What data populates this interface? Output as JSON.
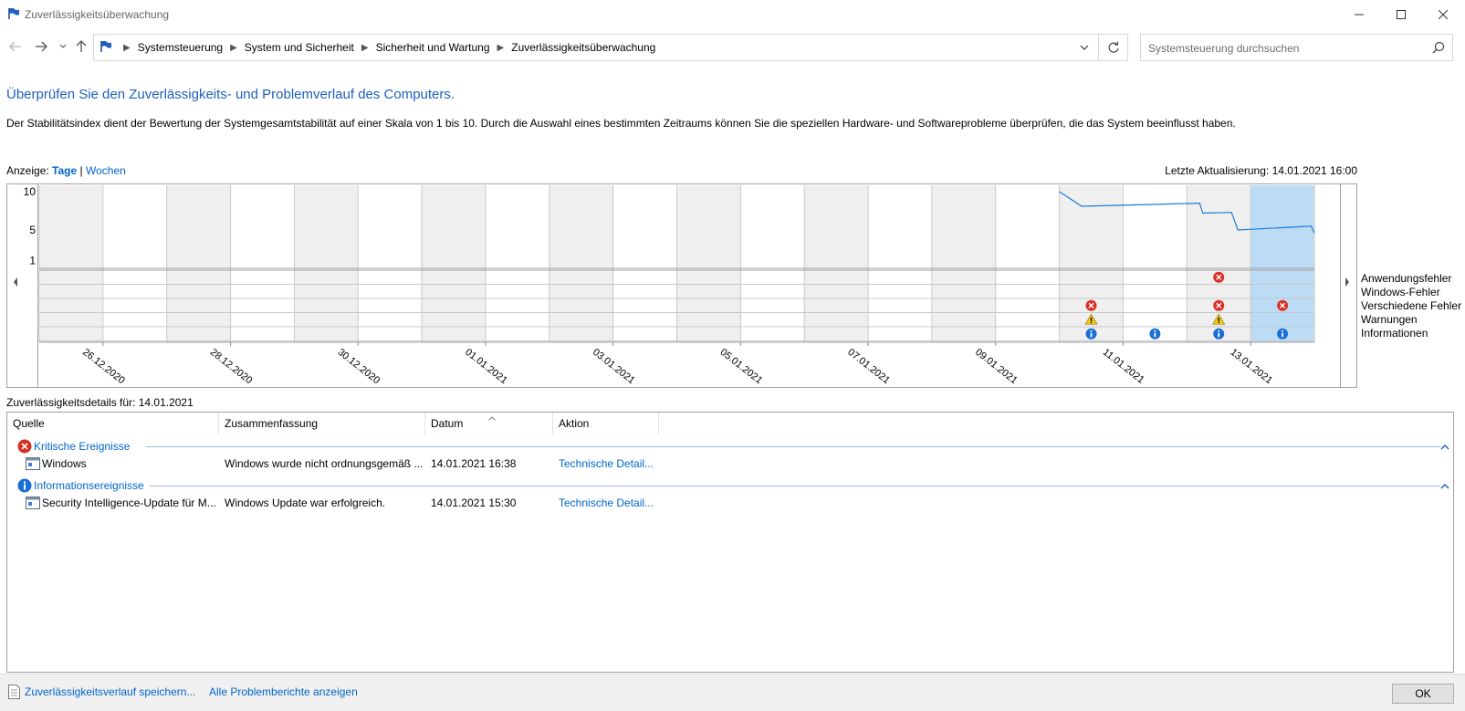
{
  "window": {
    "title": "Zuverlässigkeitsüberwachung"
  },
  "breadcrumbs": [
    "Systemsteuerung",
    "System und Sicherheit",
    "Sicherheit und Wartung",
    "Zuverlässigkeitsüberwachung"
  ],
  "search": {
    "placeholder": "Systemsteuerung durchsuchen"
  },
  "main": {
    "heading": "Überprüfen Sie den Zuverlässigkeits- und Problemverlauf des Computers.",
    "description": "Der Stabilitätsindex dient der Bewertung der Systemgesamtstabilität auf einer Skala von 1 bis 10. Durch die Auswahl eines bestimmten Zeitraums können Sie die speziellen Hardware- und Softwareprobleme überprüfen, die das System beeinflusst haben.",
    "view_label": "Anzeige:",
    "view_days": "Tage",
    "view_sep": "|",
    "view_weeks": "Wochen",
    "last_update": "Letzte Aktualisierung: 14.01.2021 16:00"
  },
  "chart_data": {
    "type": "line",
    "ylim": [
      1,
      10
    ],
    "yticks": [
      "10",
      "5",
      "1"
    ],
    "columns": 20,
    "selected_column": 19,
    "date_labels": [
      "26.12.2020",
      "28.12.2020",
      "30.12.2020",
      "01.01.2021",
      "03.01.2021",
      "05.01.2021",
      "07.01.2021",
      "09.01.2021",
      "11.01.2021",
      "13.01.2021"
    ],
    "stability": [
      {
        "x": 16.0,
        "y": 10.0
      },
      {
        "x": 16.35,
        "y": 8.1
      },
      {
        "x": 18.2,
        "y": 8.5
      },
      {
        "x": 18.25,
        "y": 7.2
      },
      {
        "x": 18.7,
        "y": 7.3
      },
      {
        "x": 18.8,
        "y": 5.0
      },
      {
        "x": 19.95,
        "y": 5.5
      },
      {
        "x": 20.0,
        "y": 4.6
      }
    ],
    "rows": [
      "Anwendungsfehler",
      "Windows-Fehler",
      "Verschiedene Fehler",
      "Warnungen",
      "Informationen"
    ],
    "events": [
      {
        "row": 0,
        "col": 18,
        "kind": "error"
      },
      {
        "row": 2,
        "col": 16,
        "kind": "error"
      },
      {
        "row": 2,
        "col": 18,
        "kind": "error"
      },
      {
        "row": 2,
        "col": 19,
        "kind": "error"
      },
      {
        "row": 3,
        "col": 16,
        "kind": "warning"
      },
      {
        "row": 3,
        "col": 18,
        "kind": "warning"
      },
      {
        "row": 4,
        "col": 16,
        "kind": "info"
      },
      {
        "row": 4,
        "col": 17,
        "kind": "info"
      },
      {
        "row": 4,
        "col": 18,
        "kind": "info"
      },
      {
        "row": 4,
        "col": 19,
        "kind": "info"
      }
    ],
    "colors": {
      "line": "#1e7bd6",
      "shade": "#efefef",
      "selected": "#bcdcf5",
      "error": "#d93025",
      "warning": "#f2c811",
      "info": "#1a6fd4"
    }
  },
  "details": {
    "label": "Zuverlässigkeitsdetails für: 14.01.2021",
    "columns": [
      "Quelle",
      "Zusammenfassung",
      "Datum",
      "Aktion"
    ],
    "groups": [
      {
        "title": "Kritische Ereignisse",
        "icon": "error-icon",
        "rows": [
          {
            "source": "Windows",
            "summary": "Windows wurde nicht ordnungsgemäß ...",
            "date": "14.01.2021 16:38",
            "action": "Technische Detail..."
          }
        ]
      },
      {
        "title": "Informationsereignisse",
        "icon": "info-icon",
        "rows": [
          {
            "source": "Security Intelligence-Update für M...",
            "summary": "Windows Update war erfolgreich.",
            "date": "14.01.2021 15:30",
            "action": "Technische Detail..."
          }
        ]
      }
    ]
  },
  "footer": {
    "save_link": "Zuverlässigkeitsverlauf speichern...",
    "all_reports_link": "Alle Problemberichte anzeigen",
    "ok_label": "OK"
  }
}
